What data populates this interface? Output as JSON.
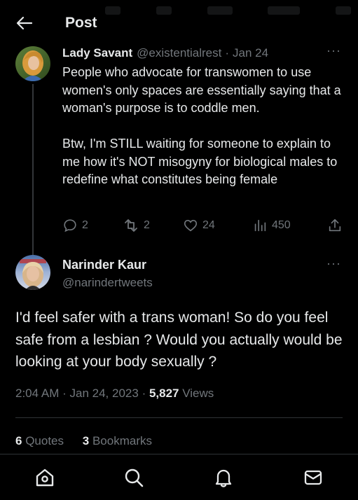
{
  "header": {
    "title": "Post"
  },
  "parent_tweet": {
    "name": "Lady Savant",
    "handle": "@existentialrest",
    "separator": "·",
    "date": "Jan 24",
    "more": "···",
    "text": "People who advocate for transwomen to use women's only spaces are essentially saying that a woman's purpose is to coddle men.\n\nBtw, I'm STILL waiting for someone to explain to me how it's NOT misogyny for biological males to redefine what constitutes being female",
    "replies": "2",
    "reposts": "2",
    "likes": "24",
    "views": "450"
  },
  "main_tweet": {
    "name": "Narinder Kaur",
    "handle": "@narindertweets",
    "more": "···",
    "text": "I'd feel safer with a trans woman! So do you feel safe from a lesbian ? Would you actually would be looking at your body sexually ?",
    "time": "2:04 AM",
    "separator1": "·",
    "date": "Jan 24, 2023",
    "separator2": "·",
    "views_count": "5,827",
    "views_label": "Views",
    "quotes_count": "6",
    "quotes_label": "Quotes",
    "bookmarks_count": "3",
    "bookmarks_label": "Bookmarks"
  },
  "icons": {
    "back": "arrow-left-icon",
    "reply": "speech-bubble-icon",
    "repost": "repost-icon",
    "like": "heart-icon",
    "views": "bar-chart-icon",
    "share": "share-icon",
    "home": "home-icon",
    "search": "search-icon",
    "notifications": "bell-icon",
    "messages": "envelope-icon"
  },
  "colors": {
    "background": "#000000",
    "text": "#e7e9ea",
    "secondary": "#71767b",
    "divider": "#2f3336"
  }
}
